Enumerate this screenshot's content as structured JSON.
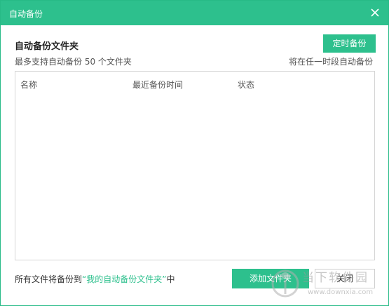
{
  "window": {
    "title": "自动备份"
  },
  "header": {
    "section_title": "自动备份文件夹",
    "subtitle": "最多支持自动备份 50 个文件夹",
    "schedule_button": "定时备份",
    "right_note": "将在任一时段自动备份"
  },
  "table": {
    "columns": [
      "名称",
      "最近备份时间",
      "状态"
    ],
    "rows": []
  },
  "footer": {
    "text_prefix": "所有文件将备份到",
    "folder_quote": "“我的自动备份文件夹”",
    "text_suffix": "中",
    "add_button": "添加文件夹",
    "close_button": "关闭"
  },
  "watermark": {
    "brand": "当下软件园",
    "url": "www.downxia.com"
  },
  "colors": {
    "accent": "#2dc08d",
    "text": "#333333",
    "border": "#d5d5d5"
  },
  "icons": {
    "close": "close-icon",
    "watermark_logo": "watermark-logo-icon"
  }
}
